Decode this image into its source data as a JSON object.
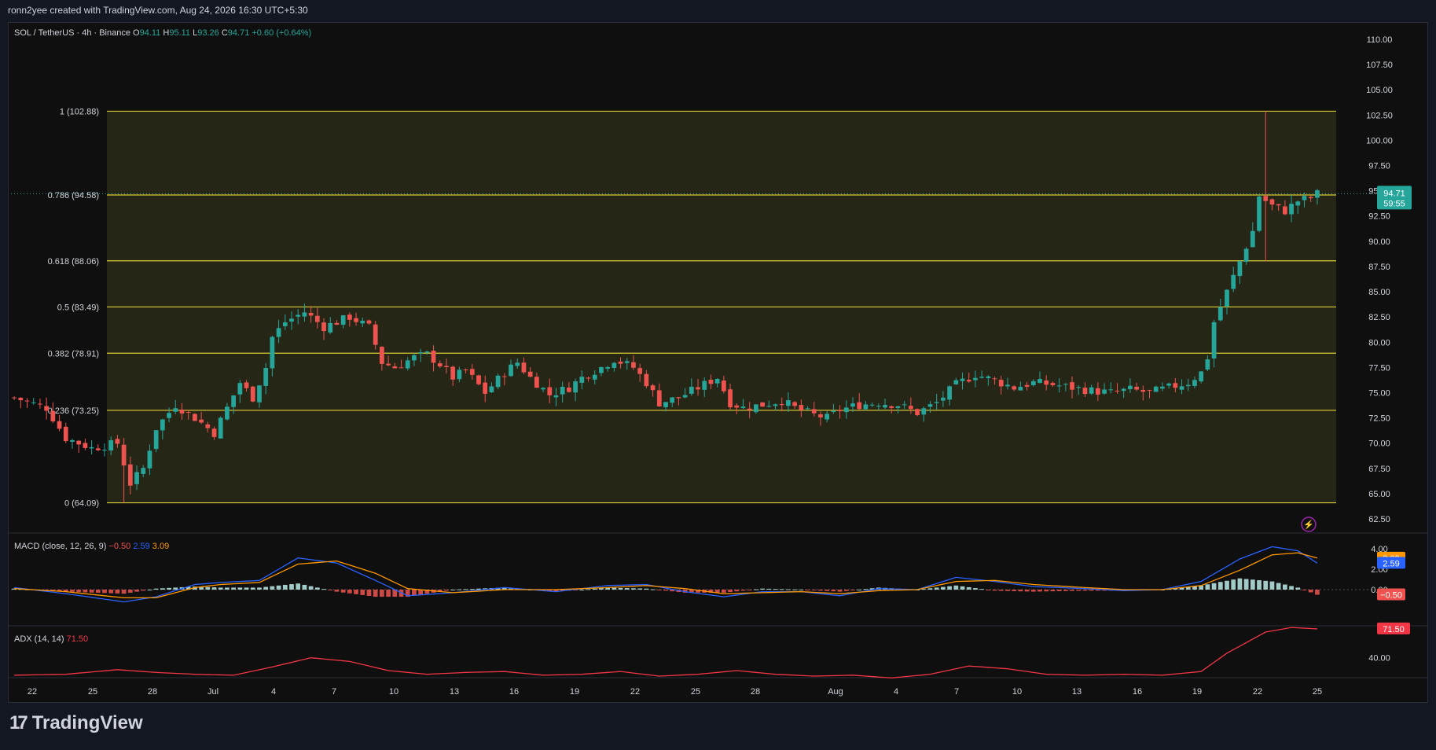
{
  "header": {
    "credit": "ronn2yee created with TradingView.com, Aug 24, 2026 16:30 UTC+5:30"
  },
  "legend": {
    "symbol": "SOL / TetherUS · 4h · Binance",
    "o_label": "O",
    "o": "94.11",
    "h_label": "H",
    "h": "95.11",
    "l_label": "L",
    "l": "93.26",
    "c_label": "C",
    "c": "94.71",
    "change": "+0.60 (+0.64%)"
  },
  "macd_legend": {
    "name": "MACD (close, 12, 26, 9)",
    "hist": "−0.50",
    "macd": "2.59",
    "signal": "3.09"
  },
  "adx_legend": {
    "name": "ADX (14, 14)",
    "value": "71.50"
  },
  "price_badge": {
    "price": "94.71",
    "countdown": "59:55"
  },
  "macd_badges": {
    "signal": "3.09",
    "macd": "2.59",
    "hist": "−0.50"
  },
  "adx_badge": "71.50",
  "footer": {
    "brand": "TradingView"
  },
  "colors": {
    "up": "#26a69a",
    "down": "#ef5350",
    "fib": "#ffeb3b",
    "macd": "#2962ff",
    "signal": "#ff9800",
    "adx": "#f23645"
  },
  "chart_data": {
    "type": "candlestick",
    "title": "SOL / TetherUS · 4h · Binance",
    "y_ticks": [
      "110.00",
      "107.50",
      "105.00",
      "102.50",
      "100.00",
      "97.50",
      "95.00",
      "92.50",
      "90.00",
      "87.50",
      "85.00",
      "82.50",
      "80.00",
      "77.50",
      "75.00",
      "72.50",
      "70.00",
      "67.50",
      "65.00",
      "62.50"
    ],
    "ylim": [
      62.5,
      110
    ],
    "x_ticks": [
      "22",
      "25",
      "28",
      "Jul",
      "4",
      "7",
      "10",
      "13",
      "16",
      "19",
      "22",
      "25",
      "28",
      "Aug",
      "4",
      "7",
      "10",
      "13",
      "16",
      "19",
      "22",
      "25"
    ],
    "fibonacci": [
      {
        "label": "1 (102.88)",
        "level": 1,
        "price": 102.88
      },
      {
        "label": "0.786 (94.58)",
        "level": 0.786,
        "price": 94.58
      },
      {
        "label": "0.618 (88.06)",
        "level": 0.618,
        "price": 88.06
      },
      {
        "label": "0.5 (83.49)",
        "level": 0.5,
        "price": 83.49
      },
      {
        "label": "0.382 (78.91)",
        "level": 0.382,
        "price": 78.91
      },
      {
        "label": "0.236 (73.25)",
        "level": 0.236,
        "price": 73.25
      },
      {
        "label": "0 (64.09)",
        "level": 0,
        "price": 64.09
      }
    ],
    "close_path": [
      [
        0,
        74.5
      ],
      [
        5,
        73.5
      ],
      [
        8,
        70.5
      ],
      [
        12,
        69.5
      ],
      [
        16,
        70.0
      ],
      [
        18,
        66.0
      ],
      [
        20,
        67.5
      ],
      [
        22,
        71.5
      ],
      [
        25,
        73.8
      ],
      [
        28,
        72.5
      ],
      [
        31,
        71.0
      ],
      [
        33,
        73.5
      ],
      [
        35,
        76.0
      ],
      [
        37,
        74.5
      ],
      [
        39,
        77.5
      ],
      [
        40,
        80.5
      ],
      [
        42,
        82.0
      ],
      [
        45,
        83.0
      ],
      [
        48,
        81.5
      ],
      [
        52,
        82.5
      ],
      [
        55,
        81.5
      ],
      [
        57,
        78.0
      ],
      [
        59,
        77.5
      ],
      [
        62,
        78.5
      ],
      [
        64,
        78.8
      ],
      [
        66,
        77.8
      ],
      [
        68,
        76.5
      ],
      [
        70,
        77.2
      ],
      [
        73,
        75.0
      ],
      [
        76,
        77.0
      ],
      [
        78,
        78.0
      ],
      [
        80,
        76.5
      ],
      [
        83,
        74.8
      ],
      [
        86,
        75.5
      ],
      [
        88,
        76.5
      ],
      [
        91,
        77.5
      ],
      [
        93,
        78.3
      ],
      [
        96,
        77.5
      ],
      [
        98,
        76.0
      ],
      [
        100,
        74.0
      ],
      [
        103,
        74.5
      ],
      [
        106,
        75.5
      ],
      [
        109,
        76.5
      ],
      [
        111,
        74.0
      ],
      [
        113,
        73.5
      ],
      [
        116,
        73.8
      ],
      [
        119,
        74.2
      ],
      [
        121,
        73.5
      ],
      [
        124,
        72.8
      ],
      [
        126,
        72.5
      ],
      [
        128,
        73.3
      ],
      [
        131,
        73.8
      ],
      [
        134,
        74.0
      ],
      [
        137,
        73.8
      ],
      [
        140,
        73.0
      ],
      [
        143,
        74.0
      ],
      [
        146,
        75.8
      ],
      [
        149,
        76.8
      ],
      [
        152,
        76.2
      ],
      [
        155,
        75.5
      ],
      [
        158,
        76.0
      ],
      [
        161,
        75.8
      ],
      [
        164,
        75.5
      ],
      [
        167,
        75.2
      ],
      [
        170,
        75.0
      ],
      [
        173,
        75.3
      ],
      [
        176,
        75.0
      ],
      [
        179,
        75.5
      ],
      [
        182,
        76.0
      ],
      [
        184,
        77.0
      ],
      [
        185,
        78.5
      ],
      [
        186,
        82.0
      ],
      [
        188,
        85.0
      ],
      [
        190,
        88.0
      ],
      [
        192,
        91.0
      ],
      [
        193,
        94.5
      ],
      [
        195,
        93.5
      ],
      [
        197,
        93.0
      ],
      [
        199,
        94.0
      ],
      [
        201,
        94.3
      ],
      [
        202,
        94.71
      ]
    ],
    "candle_count": 203,
    "macd_ylim": [
      -2,
      4
    ],
    "macd_ticks": [
      "4.00",
      "2.00",
      "0.00"
    ],
    "macd_line": [
      [
        0,
        0.2
      ],
      [
        8,
        -0.4
      ],
      [
        17,
        -1.2
      ],
      [
        22,
        -0.7
      ],
      [
        28,
        0.5
      ],
      [
        32,
        0.7
      ],
      [
        38,
        0.9
      ],
      [
        44,
        3.1
      ],
      [
        50,
        2.6
      ],
      [
        56,
        0.9
      ],
      [
        61,
        -0.6
      ],
      [
        68,
        -0.3
      ],
      [
        76,
        0.2
      ],
      [
        84,
        -0.2
      ],
      [
        92,
        0.4
      ],
      [
        98,
        0.5
      ],
      [
        104,
        -0.2
      ],
      [
        110,
        -0.7
      ],
      [
        116,
        -0.2
      ],
      [
        122,
        -0.2
      ],
      [
        128,
        -0.6
      ],
      [
        134,
        0.1
      ],
      [
        140,
        0.0
      ],
      [
        146,
        1.2
      ],
      [
        152,
        0.8
      ],
      [
        158,
        0.3
      ],
      [
        166,
        0.1
      ],
      [
        172,
        -0.1
      ],
      [
        178,
        0.0
      ],
      [
        184,
        0.8
      ],
      [
        190,
        3.0
      ],
      [
        195,
        4.2
      ],
      [
        199,
        3.8
      ],
      [
        202,
        2.59
      ]
    ],
    "signal_line": [
      [
        0,
        0.1
      ],
      [
        8,
        -0.2
      ],
      [
        17,
        -0.8
      ],
      [
        22,
        -0.8
      ],
      [
        28,
        0.2
      ],
      [
        32,
        0.5
      ],
      [
        38,
        0.7
      ],
      [
        44,
        2.5
      ],
      [
        50,
        2.8
      ],
      [
        56,
        1.6
      ],
      [
        61,
        0.1
      ],
      [
        68,
        -0.3
      ],
      [
        76,
        0.0
      ],
      [
        84,
        0.0
      ],
      [
        92,
        0.2
      ],
      [
        98,
        0.4
      ],
      [
        104,
        0.1
      ],
      [
        110,
        -0.4
      ],
      [
        116,
        -0.3
      ],
      [
        122,
        -0.2
      ],
      [
        128,
        -0.4
      ],
      [
        134,
        -0.1
      ],
      [
        140,
        0.0
      ],
      [
        146,
        0.8
      ],
      [
        152,
        0.9
      ],
      [
        158,
        0.5
      ],
      [
        166,
        0.2
      ],
      [
        172,
        0.0
      ],
      [
        178,
        0.0
      ],
      [
        184,
        0.4
      ],
      [
        190,
        1.9
      ],
      [
        195,
        3.4
      ],
      [
        199,
        3.6
      ],
      [
        202,
        3.09
      ]
    ],
    "adx_ylim": [
      20,
      80
    ],
    "adx_ticks": [
      "40.00"
    ],
    "adx_line": [
      [
        0,
        21
      ],
      [
        8,
        22
      ],
      [
        16,
        27
      ],
      [
        22,
        24
      ],
      [
        28,
        22
      ],
      [
        34,
        21
      ],
      [
        40,
        30
      ],
      [
        46,
        40
      ],
      [
        52,
        36
      ],
      [
        58,
        26
      ],
      [
        64,
        22
      ],
      [
        70,
        24
      ],
      [
        76,
        25
      ],
      [
        82,
        21
      ],
      [
        88,
        22
      ],
      [
        94,
        25
      ],
      [
        100,
        20
      ],
      [
        106,
        22
      ],
      [
        112,
        26
      ],
      [
        118,
        22
      ],
      [
        124,
        20
      ],
      [
        130,
        21
      ],
      [
        136,
        18
      ],
      [
        142,
        22
      ],
      [
        148,
        31
      ],
      [
        154,
        28
      ],
      [
        160,
        22
      ],
      [
        166,
        21
      ],
      [
        172,
        22
      ],
      [
        178,
        21
      ],
      [
        184,
        25
      ],
      [
        188,
        45
      ],
      [
        194,
        68
      ],
      [
        198,
        73
      ],
      [
        202,
        71.5
      ]
    ]
  }
}
